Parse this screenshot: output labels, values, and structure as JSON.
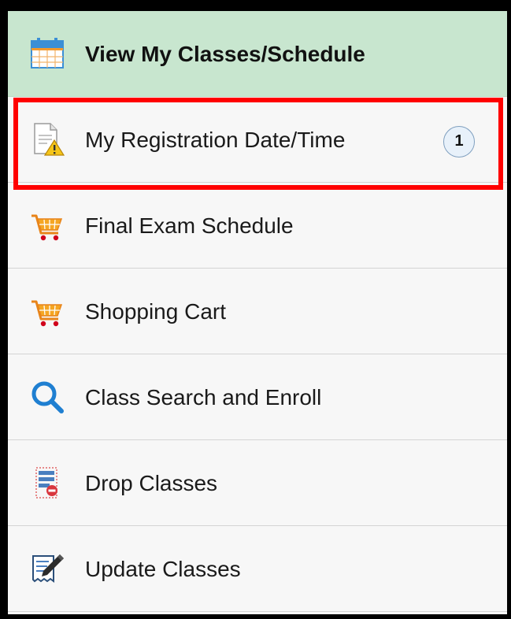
{
  "menu": {
    "items": [
      {
        "label": "View My Classes/Schedule",
        "icon": "calendar-icon",
        "active": true
      },
      {
        "label": "My Registration Date/Time",
        "icon": "document-warning-icon",
        "badge": "1",
        "highlighted": true
      },
      {
        "label": "Final Exam Schedule",
        "icon": "shopping-cart-icon"
      },
      {
        "label": "Shopping Cart",
        "icon": "shopping-cart-icon"
      },
      {
        "label": "Class Search and Enroll",
        "icon": "search-icon"
      },
      {
        "label": "Drop Classes",
        "icon": "drop-list-icon"
      },
      {
        "label": "Update Classes",
        "icon": "edit-document-icon"
      }
    ]
  },
  "colors": {
    "active_background": "#c8e6cf",
    "highlight_border": "#ff0000",
    "badge_background": "#e8f1fa"
  }
}
